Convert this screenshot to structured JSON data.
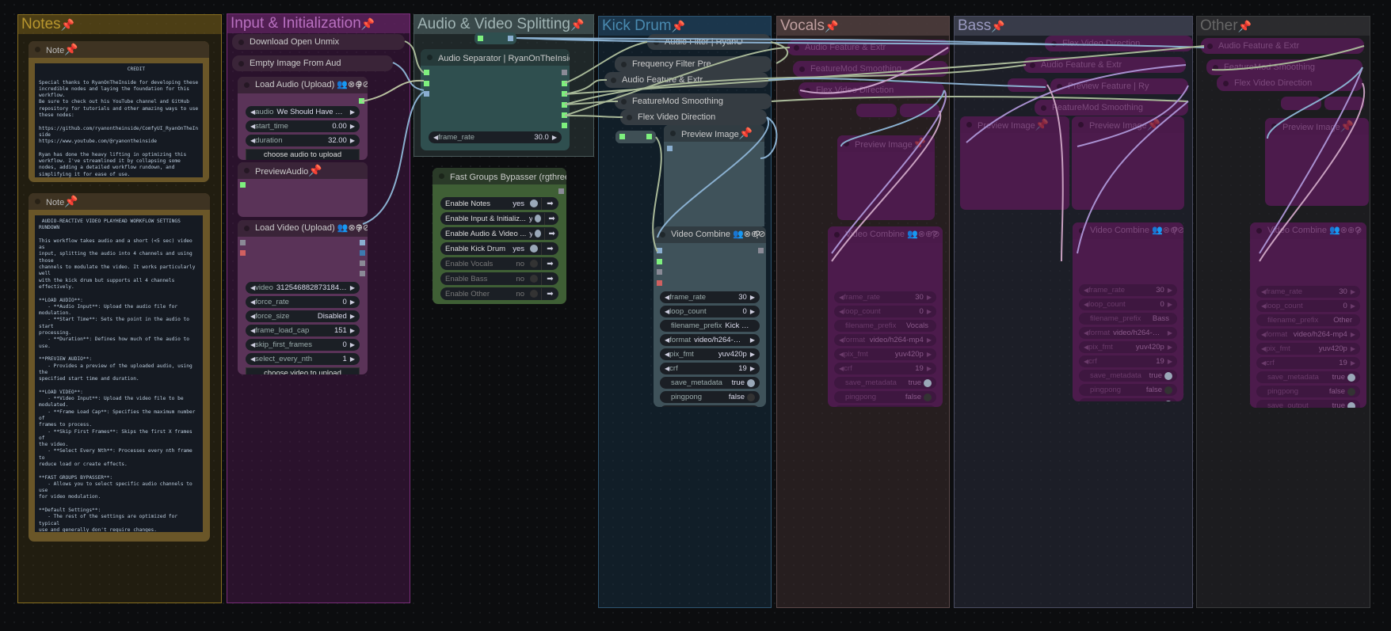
{
  "groups": {
    "notes": {
      "title": "Notes",
      "color": "#b8962e"
    },
    "input": {
      "title": "Input & Initialization",
      "color": "#a25ca8"
    },
    "split": {
      "title": "Audio & Video Splitting",
      "color": "#88a0a0"
    },
    "kick": {
      "title": "Kick Drum",
      "color": "#4a8ab0"
    },
    "vocals": {
      "title": "Vocals",
      "color": "#a88a8a"
    },
    "bass": {
      "title": "Bass",
      "color": "#8a8ab0"
    },
    "other": {
      "title": "Other",
      "color": "#555"
    }
  },
  "notes": {
    "note1": {
      "title": "Note",
      "text": "                              CREDIT\n\nSpecial thanks to RyanOnTheInside for developing these\nincredible nodes and laying the foundation for this\nworkflow.\nBe sure to check out his YouTube channel and GitHub\nrepository for tutorials and other amazing ways to use\nthese nodes:\n\nhttps://github.com/ryanontheinside/ComfyUI_RyanOnTheIn\nside\nhttps://www.youtube.com/@ryanontheinside\n\nRyan has done the heavy lifting in optimizing this\nworkflow. I've streamlined it by collapsing some\nnodes, adding a detailed workflow rundown, and\nsimplifying it for ease of use."
    },
    "note2": {
      "title": "Note",
      "text": " AUDIO-REACTIVE VIDEO PLAYHEAD WORKFLOW SETTINGS RUNDOWN\n\nThis workflow takes audio and a short (<5 sec) video as\ninput, splitting the audio into 4 channels and using those\nchannels to modulate the video. It works particularly well\nwith the kick drum but supports all 4 channels\neffectively.\n\n**LOAD AUDIO**:\n   - **Audio Input**: Upload the audio file for\nmodulation.\n   - **Start Time**: Sets the point in the audio to start\nprocessing.\n   - **Duration**: Defines how much of the audio to use.\n\n**PREVIEW AUDIO**:\n   - Provides a preview of the uploaded audio, using the\nspecified start time and duration.\n\n**LOAD VIDEO**:\n   - **Video Input**: Upload the video file to be\nmodulated.\n   - **Frame Load Cap**: Specifies the maximum number of\nframes to process.\n   - **Skip First Frames**: Skips the first X frames of\nthe video.\n   - **Select Every Nth**: Processes every nth frame to\nreduce load or create effects.\n\n**FAST GROUPS BYPASSER**:\n   - Allows you to select specific audio channels to use\nfor video modulation.\n\n**Default Settings**:\n   - The rest of the settings are optimized for typical\nuse and generally don't require changes.\n\n**Output**:\n   - The videos are automatically saved to your ComfyUI\noutput folder with a relevant prefix for easy\nidentification.\n\nThis workflow is straightforward and efficient, providing\na dynamic way to create audio-reactive video effects.\n\n-----------------------------------------------------------\n\nLove,\n\nu/weshouldhaveshotguns"
    }
  },
  "input": {
    "download_unmix": "Download Open Unmix",
    "empty_image": "Empty Image From Aud",
    "load_audio": {
      "title": "Load Audio (Upload) 👥⊗⊕⊘",
      "help": "?",
      "widgets": [
        {
          "kind": "num",
          "label": "audio",
          "value": "We Should Have Sh..."
        },
        {
          "kind": "num",
          "label": "start_time",
          "value": "0.00"
        },
        {
          "kind": "num",
          "label": "duration",
          "value": "32.00"
        }
      ],
      "button": "choose audio to upload"
    },
    "preview_audio": {
      "title": "PreviewAudio"
    },
    "load_video": {
      "title": "Load Video (Upload) 👥⊗⊕⊘",
      "help": "?",
      "widgets": [
        {
          "kind": "num",
          "label": "video",
          "value": "31254688287318426..."
        },
        {
          "kind": "num",
          "label": "force_rate",
          "value": "0"
        },
        {
          "kind": "num",
          "label": "force_size",
          "value": "Disabled"
        },
        {
          "kind": "num",
          "label": "frame_load_cap",
          "value": "151"
        },
        {
          "kind": "num",
          "label": "skip_first_frames",
          "value": "0"
        },
        {
          "kind": "num",
          "label": "select_every_nth",
          "value": "1"
        }
      ],
      "button": "choose video to upload"
    }
  },
  "split": {
    "separator": {
      "title": "Audio Separator | RyanOnTheInside",
      "widgets": [
        {
          "kind": "num",
          "label": "frame_rate",
          "value": "30.0"
        }
      ]
    },
    "bypasser": {
      "title": "Fast Groups Bypasser (rgthree)",
      "arrow": "➡",
      "toggles": [
        {
          "label": "Enable Notes",
          "value": "yes",
          "on": true
        },
        {
          "label": "Enable Input & Initializ...",
          "value": "yes",
          "on": true
        },
        {
          "label": "Enable Audio & Video ...",
          "value": "yes",
          "on": true
        },
        {
          "label": "Enable Kick Drum",
          "value": "yes",
          "on": true
        },
        {
          "label": "Enable Vocals",
          "value": "no",
          "on": false
        },
        {
          "label": "Enable Bass",
          "value": "no",
          "on": false
        },
        {
          "label": "Enable Other",
          "value": "no",
          "on": false
        }
      ]
    }
  },
  "kick": {
    "audio_filter": "Audio Filter | RyanO",
    "freq_filter": "Frequency Filter Pre",
    "audio_feature": "Audio Feature & Extr",
    "featuremod": "FeatureMod Smoothing",
    "flex_video": "Flex Video Direction",
    "preview_image": "Preview Image",
    "video_combine": {
      "title": "Video Combine 👥⊗⊕⊘",
      "help": "?",
      "widgets": [
        {
          "kind": "num",
          "label": "frame_rate",
          "value": "30"
        },
        {
          "kind": "num",
          "label": "loop_count",
          "value": "0"
        },
        {
          "kind": "text",
          "label": "filename_prefix",
          "value": "Kick Drum"
        },
        {
          "kind": "num",
          "label": "format",
          "value": "video/h264-mp4"
        },
        {
          "kind": "num",
          "label": "pix_fmt",
          "value": "yuv420p"
        },
        {
          "kind": "num",
          "label": "crf",
          "value": "19"
        },
        {
          "kind": "toggle",
          "label": "save_metadata",
          "value": "true",
          "on": true
        },
        {
          "kind": "toggle",
          "label": "pingpong",
          "value": "false",
          "on": false
        },
        {
          "kind": "toggle",
          "label": "save_output",
          "value": "true",
          "on": true
        }
      ]
    }
  },
  "vocals": {
    "audio_feature": "Audio Feature & Extr",
    "featuremod": "FeatureMod Smoothing",
    "flex_video": "Flex Video Direction",
    "preview_image": "Preview Image",
    "video_combine": {
      "title": "Video Combine 👥⊗⊕⊘",
      "help": "?",
      "widgets": [
        {
          "kind": "num",
          "label": "frame_rate",
          "value": "30"
        },
        {
          "kind": "num",
          "label": "loop_count",
          "value": "0"
        },
        {
          "kind": "text",
          "label": "filename_prefix",
          "value": "Vocals"
        },
        {
          "kind": "num",
          "label": "format",
          "value": "video/h264-mp4"
        },
        {
          "kind": "num",
          "label": "pix_fmt",
          "value": "yuv420p"
        },
        {
          "kind": "num",
          "label": "crf",
          "value": "19"
        },
        {
          "kind": "toggle",
          "label": "save_metadata",
          "value": "true",
          "on": true
        },
        {
          "kind": "toggle",
          "label": "pingpong",
          "value": "false",
          "on": false
        },
        {
          "kind": "toggle",
          "label": "save_output",
          "value": "true",
          "on": true
        }
      ]
    }
  },
  "bass": {
    "flex_video": "Flex Video Direction",
    "audio_feature": "Audio Feature & Extr",
    "preview_feature": "Preview Feature | Ry",
    "featuremod": "FeatureMod Smoothing",
    "preview_image_1": "Preview Image",
    "preview_image_2": "Preview Image",
    "video_combine": {
      "title": "Video Combine 👥⊗⊕⊘",
      "help": "?",
      "widgets": [
        {
          "kind": "num",
          "label": "frame_rate",
          "value": "30"
        },
        {
          "kind": "num",
          "label": "loop_count",
          "value": "0"
        },
        {
          "kind": "text",
          "label": "filename_prefix",
          "value": "Bass"
        },
        {
          "kind": "num",
          "label": "format",
          "value": "video/h264-mp4"
        },
        {
          "kind": "num",
          "label": "pix_fmt",
          "value": "yuv420p"
        },
        {
          "kind": "num",
          "label": "crf",
          "value": "19"
        },
        {
          "kind": "toggle",
          "label": "save_metadata",
          "value": "true",
          "on": true
        },
        {
          "kind": "toggle",
          "label": "pingpong",
          "value": "false",
          "on": false
        },
        {
          "kind": "toggle",
          "label": "save_output",
          "value": "true",
          "on": true
        }
      ]
    }
  },
  "other": {
    "audio_feature": "Audio Feature & Extr",
    "featuremod": "FeatureMod Smoothing",
    "flex_video": "Flex Video Direction",
    "preview_image": "Preview Image",
    "video_combine": {
      "title": "Video Combine 👥⊗⊕⊘",
      "help": "?",
      "widgets": [
        {
          "kind": "num",
          "label": "frame_rate",
          "value": "30"
        },
        {
          "kind": "num",
          "label": "loop_count",
          "value": "0"
        },
        {
          "kind": "text",
          "label": "filename_prefix",
          "value": "Other"
        },
        {
          "kind": "num",
          "label": "format",
          "value": "video/h264-mp4"
        },
        {
          "kind": "num",
          "label": "pix_fmt",
          "value": "yuv420p"
        },
        {
          "kind": "num",
          "label": "crf",
          "value": "19"
        },
        {
          "kind": "toggle",
          "label": "save_metadata",
          "value": "true",
          "on": true
        },
        {
          "kind": "toggle",
          "label": "pingpong",
          "value": "false",
          "on": false
        },
        {
          "kind": "toggle",
          "label": "save_output",
          "value": "true",
          "on": true
        }
      ]
    }
  },
  "pin_icon": "📌"
}
